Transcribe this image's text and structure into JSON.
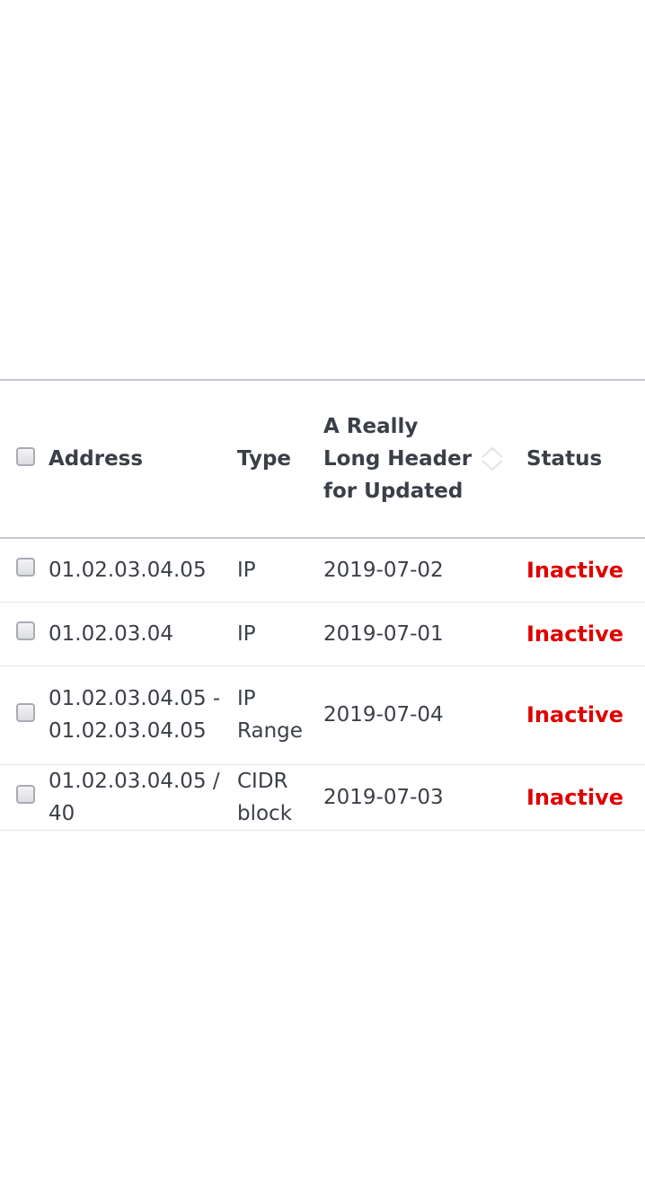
{
  "table": {
    "headers": {
      "address": "Address",
      "type": "Type",
      "updated": "A Really Long Header for Updated",
      "status": "Status"
    },
    "rows": [
      {
        "address": "01.02.03.04.05",
        "type": "IP",
        "updated": "2019-07-02",
        "status": "Inactive"
      },
      {
        "address": "01.02.03.04",
        "type": "IP",
        "updated": "2019-07-01",
        "status": "Inactive"
      },
      {
        "address": "01.02.03.04.05 - 01.02.03.04.05",
        "type": "IP Range",
        "updated": "2019-07-04",
        "status": "Inactive"
      },
      {
        "address": "01.02.03.04.05 / 40",
        "type": "CIDR block",
        "updated": "2019-07-03",
        "status": "Inactive"
      }
    ]
  },
  "colors": {
    "status_inactive": "#e00000",
    "text": "#3b3f47",
    "border": "#c5c7d0"
  },
  "icons": {
    "sort": "sort-icon",
    "checkbox": "checkbox"
  }
}
